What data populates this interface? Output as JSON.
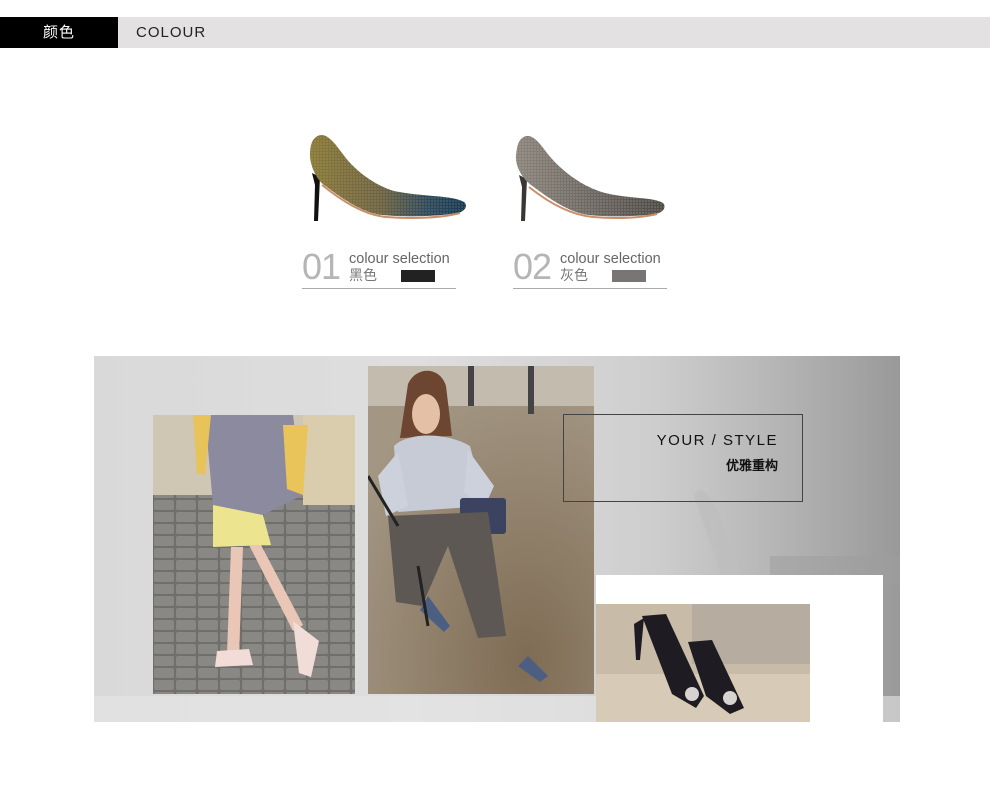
{
  "header": {
    "label_cn": "颜色",
    "label_en": "COLOUR"
  },
  "colours": [
    {
      "number": "01",
      "title": "colour selection",
      "name_cn": "黑色",
      "chip_color": "#222222"
    },
    {
      "number": "02",
      "title": "colour selection",
      "name_cn": "灰色",
      "chip_color": "#7a7575"
    }
  ],
  "style_banner": {
    "title_en": "YOUR / STYLE",
    "title_cn": "优雅重构"
  },
  "colors": {
    "header_bar": "#e3e1e2",
    "header_tag": "#000000",
    "border": "#444444"
  }
}
